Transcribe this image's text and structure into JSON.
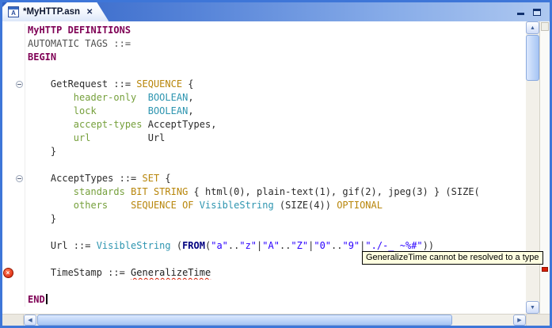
{
  "window": {
    "titlebar": {
      "tab": {
        "title": "*MyHTTP.asn",
        "icon_letter": "A",
        "close_glyph": "✕"
      }
    }
  },
  "icons": {
    "scroll_up": "▲",
    "scroll_down": "▼",
    "scroll_left": "◀",
    "scroll_right": "▶",
    "error_glyph": "×"
  },
  "colors": {
    "window_border": "#3E76D8",
    "titlebar_gradient_start": "#2E60C4",
    "titlebar_gradient_end": "#AEC8F0",
    "tooltip_bg": "#FFFFE1",
    "error_red": "#D81E05",
    "scrollbar_thumb": "#A6C5F4",
    "editor_bg": "#FFFFFF"
  },
  "editor": {
    "styles": {
      "kw": {
        "color": "#7F0055",
        "bold": true
      },
      "dim": {
        "color": "#4F4F4F",
        "bold": false
      },
      "p": {
        "color": "#2B2B2B",
        "bold": false
      },
      "field": {
        "color": "#76A03C",
        "bold": false
      },
      "type": {
        "color": "#B8860B",
        "bold": false
      },
      "builtin": {
        "color": "#2E95B0",
        "bold": false
      },
      "str": {
        "color": "#2A00FF",
        "bold": false
      },
      "from": {
        "color": "#000080",
        "bold": true
      },
      "err": {
        "color": "#1E1E1E",
        "bold": false,
        "error": true
      }
    },
    "fold_lines": [
      4,
      11
    ],
    "error_marker_line": 18,
    "caret_line": 20,
    "lines": [
      [
        [
          "kw",
          "MyHTTP"
        ],
        [
          "p",
          " "
        ],
        [
          "kw",
          "DEFINITIONS"
        ]
      ],
      [
        [
          "dim",
          "AUTOMATIC TAGS ::="
        ]
      ],
      [
        [
          "kw",
          "BEGIN"
        ]
      ],
      [],
      [
        [
          "p",
          "    GetRequest ::= "
        ],
        [
          "type",
          "SEQUENCE"
        ],
        [
          "p",
          " {"
        ]
      ],
      [
        [
          "p",
          "        "
        ],
        [
          "field",
          "header-only"
        ],
        [
          "p",
          "  "
        ],
        [
          "builtin",
          "BOOLEAN"
        ],
        [
          "p",
          ","
        ]
      ],
      [
        [
          "p",
          "        "
        ],
        [
          "field",
          "lock"
        ],
        [
          "p",
          "         "
        ],
        [
          "builtin",
          "BOOLEAN"
        ],
        [
          "p",
          ","
        ]
      ],
      [
        [
          "p",
          "        "
        ],
        [
          "field",
          "accept-types"
        ],
        [
          "p",
          " AcceptTypes,"
        ]
      ],
      [
        [
          "p",
          "        "
        ],
        [
          "field",
          "url"
        ],
        [
          "p",
          "          Url"
        ]
      ],
      [
        [
          "p",
          "    }"
        ]
      ],
      [],
      [
        [
          "p",
          "    AcceptTypes ::= "
        ],
        [
          "type",
          "SET"
        ],
        [
          "p",
          " {"
        ]
      ],
      [
        [
          "p",
          "        "
        ],
        [
          "field",
          "standards"
        ],
        [
          "p",
          " "
        ],
        [
          "type",
          "BIT STRING"
        ],
        [
          "p",
          " { html(0), plain-text(1), gif(2), jpeg(3) } (SIZE("
        ]
      ],
      [
        [
          "p",
          "        "
        ],
        [
          "field",
          "others"
        ],
        [
          "p",
          "    "
        ],
        [
          "type",
          "SEQUENCE OF"
        ],
        [
          "p",
          " "
        ],
        [
          "builtin",
          "VisibleString"
        ],
        [
          "p",
          " (SIZE(4)) "
        ],
        [
          "type",
          "OPTIONAL"
        ]
      ],
      [
        [
          "p",
          "    }"
        ]
      ],
      [],
      [
        [
          "p",
          "    Url ::= "
        ],
        [
          "builtin",
          "VisibleString"
        ],
        [
          "p",
          " ("
        ],
        [
          "from",
          "FROM"
        ],
        [
          "p",
          "("
        ],
        [
          "str",
          "\"a\""
        ],
        [
          "p",
          ".."
        ],
        [
          "str",
          "\"z\""
        ],
        [
          "p",
          "|"
        ],
        [
          "str",
          "\"A\""
        ],
        [
          "p",
          ".."
        ],
        [
          "str",
          "\"Z\""
        ],
        [
          "p",
          "|"
        ],
        [
          "str",
          "\"0\""
        ],
        [
          "p",
          ".."
        ],
        [
          "str",
          "\"9\""
        ],
        [
          "p",
          "|"
        ],
        [
          "str",
          "\"./-_ ~%#\""
        ],
        [
          "p",
          "))"
        ]
      ],
      [],
      [
        [
          "p",
          "    TimeStamp ::= "
        ],
        [
          "err",
          "GeneralizeTime"
        ]
      ],
      [],
      [
        [
          "kw",
          "END"
        ]
      ]
    ]
  },
  "tooltip": {
    "text": "GeneralizeTime cannot be resolved to a type"
  }
}
